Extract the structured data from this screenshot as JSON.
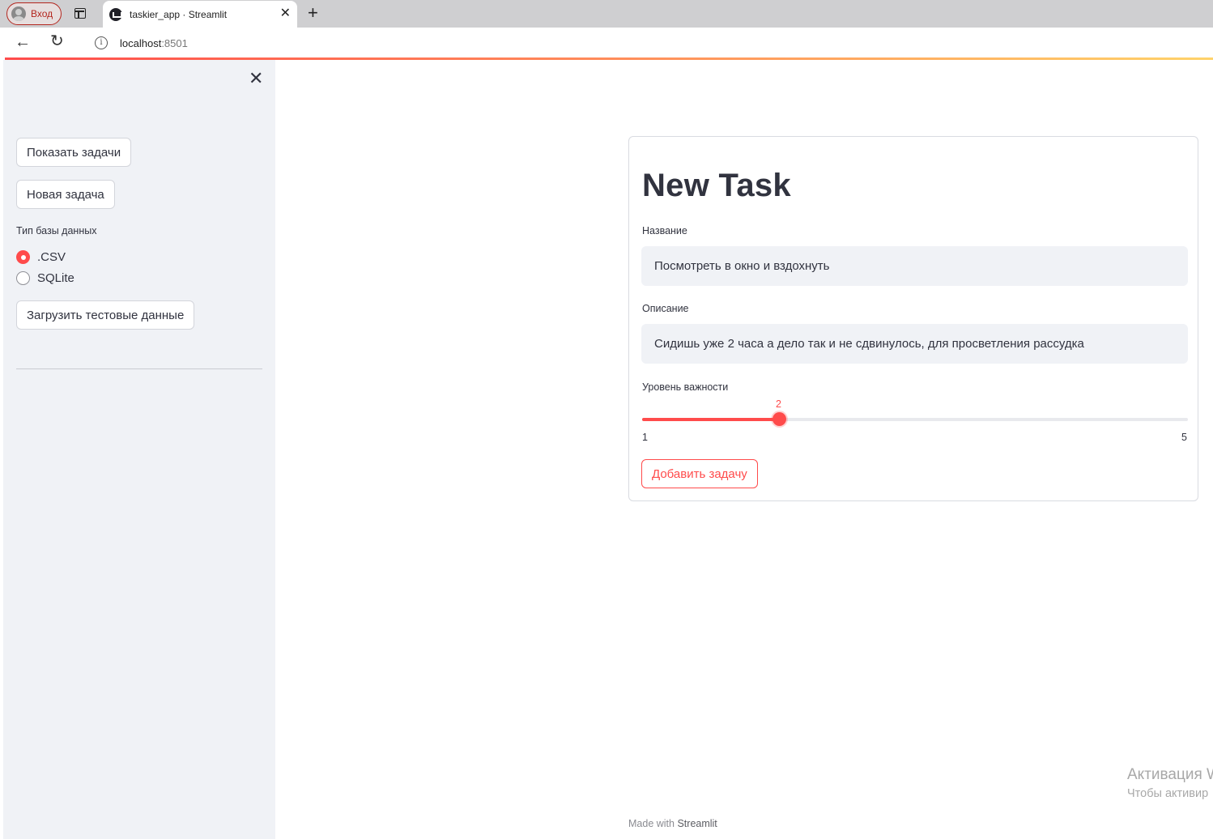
{
  "browser": {
    "profile_label": "Вход",
    "tab_title": "taskier_app · Streamlit",
    "tab_close": "✕",
    "new_tab": "+",
    "back": "←",
    "reload": "↻",
    "info": "i",
    "url_host": "localhost",
    "url_port": ":8501"
  },
  "sidebar": {
    "close": "✕",
    "show_tasks_button": "Показать задачи",
    "new_task_button": "Новая задача",
    "db_type_label": "Тип базы данных",
    "db_options": [
      ".CSV",
      "SQLite"
    ],
    "db_selected": ".CSV",
    "load_test_data_button": "Загрузить тестовые данные"
  },
  "form": {
    "title": "New Task",
    "name_label": "Название",
    "name_value": "Посмотреть в окно и вздохнуть",
    "description_label": "Описание",
    "description_value": "Сидишь уже 2 часа а дело так и не сдвинулось, для просветления рассудка",
    "importance_label": "Уровень важности",
    "importance": {
      "min": 1,
      "max": 5,
      "value": 2,
      "min_label": "1",
      "max_label": "5",
      "value_label": "2"
    },
    "submit_button": "Добавить задачу"
  },
  "footer": {
    "made_with": "Made with",
    "brand": "Streamlit"
  },
  "watermark": {
    "line1": "Активация W",
    "line2": "Чтобы активир"
  },
  "colors": {
    "accent": "#ff4b4b",
    "sidebar_bg": "#f0f2f6",
    "text": "#31333f"
  }
}
